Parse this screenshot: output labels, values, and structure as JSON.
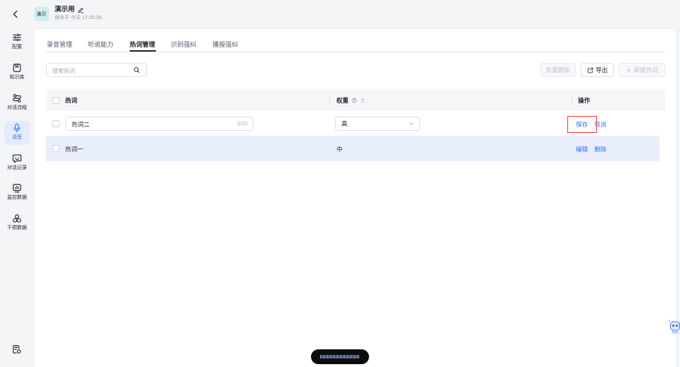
{
  "sidebar": {
    "back_icon": "chevron-left-icon",
    "items": [
      {
        "label": "配置",
        "icon": "sliders-icon"
      },
      {
        "label": "知识库",
        "icon": "bookmark-box-icon"
      },
      {
        "label": "对话流程",
        "icon": "flow-icon"
      },
      {
        "label": "语音",
        "icon": "microphone-icon",
        "active": true
      },
      {
        "label": "对话记录",
        "icon": "chat-bubble-icon"
      },
      {
        "label": "监控数据",
        "icon": "chart-box-icon"
      },
      {
        "label": "干预数据",
        "icon": "circles-icon"
      }
    ],
    "footer_icon": "document-settings-icon"
  },
  "header": {
    "avatar_text": "演示",
    "title": "演示用",
    "edit_icon": "pencil-icon",
    "saved_text": "保存于 今天 17:20:39"
  },
  "tabs": {
    "items": [
      {
        "label": "录音管理"
      },
      {
        "label": "听说能力"
      },
      {
        "label": "热词管理",
        "active": true
      },
      {
        "label": "识别强纠"
      },
      {
        "label": "播报强纠"
      }
    ]
  },
  "toolbar": {
    "search_placeholder": "搜索热词",
    "search_icon": "search-icon",
    "batch_delete_label": "批量删除",
    "batch_delete_disabled": true,
    "export_label": "导出",
    "export_icon": "export-icon",
    "new_label": "新建热词",
    "new_icon": "plus-icon",
    "new_disabled": true
  },
  "table": {
    "columns": {
      "word": "热词",
      "weight": "权重",
      "weight_icons": [
        "help-circle-icon",
        "sort-icon"
      ],
      "actions": "操作"
    },
    "editing_row": {
      "word_value": "热词二",
      "counter": "3/10",
      "weight_value": "高",
      "save_label": "保存",
      "cancel_label": "取消"
    },
    "rows": [
      {
        "word": "热词一",
        "weight": "中",
        "edit_label": "编辑",
        "delete_label": "删除",
        "highlighted": true
      }
    ]
  },
  "floating": {
    "voice_bar_icon": "waveform-icon",
    "assistant_icon": "assistant-mascot-icon"
  },
  "colors": {
    "accent": "#3370ff",
    "side_active_bg": "#e3ecff",
    "avatar_bg": "#cdeff0",
    "row_highlight": "#e8eefc",
    "annotation_box": "#e53935",
    "floating_bar": "#0d0d0d"
  }
}
